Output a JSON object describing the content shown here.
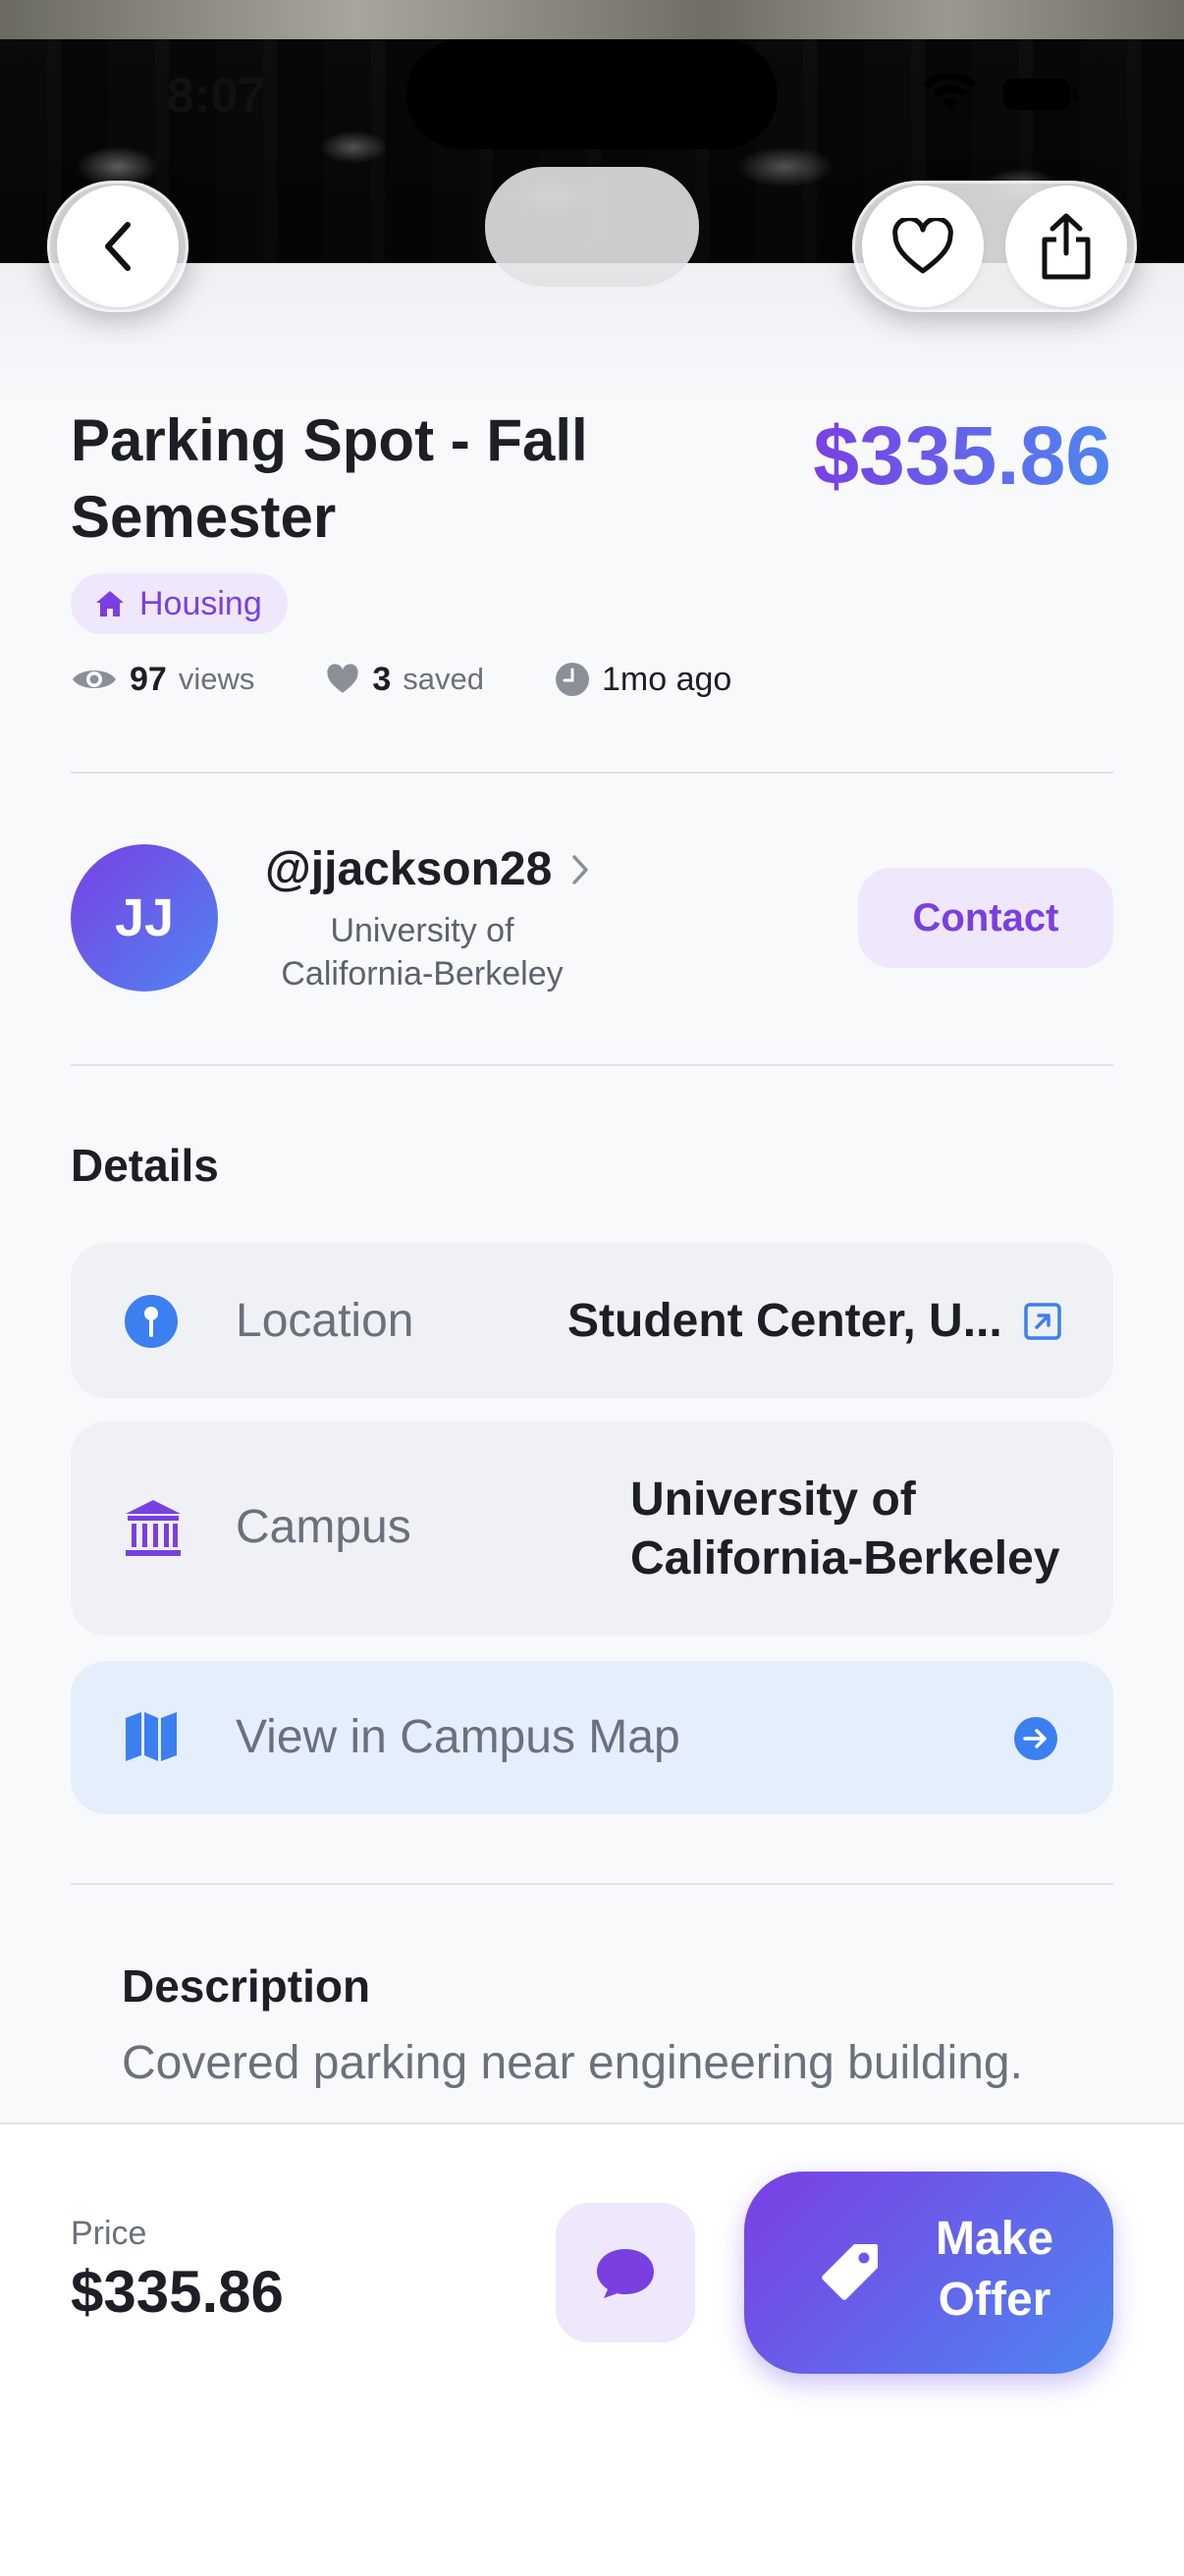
{
  "status_bar": {
    "time": "8:07"
  },
  "listing": {
    "title": "Parking Spot - Fall Semester",
    "price": "$335.86",
    "category": "Housing",
    "stats": {
      "views_count": "97",
      "views_label": "views",
      "saved_count": "3",
      "saved_label": "saved",
      "posted": "1mo ago"
    }
  },
  "seller": {
    "initials": "JJ",
    "username": "@jjackson28",
    "school": "University of California-Berkeley",
    "contact_label": "Contact"
  },
  "details": {
    "heading": "Details",
    "location_label": "Location",
    "location_value": "Student Center, U...",
    "campus_label": "Campus",
    "campus_value": "University of California-Berkeley",
    "map_label": "View in Campus Map"
  },
  "description": {
    "heading": "Description",
    "text": "Covered parking near engineering building."
  },
  "bottom_bar": {
    "price_label": "Price",
    "price": "$335.86",
    "offer_label": "Make Offer"
  },
  "colors": {
    "accent_purple": "#7b3fe4",
    "accent_blue": "#4e86f0",
    "badge_bg": "#efe7fc"
  },
  "icons": [
    "back-chevron-icon",
    "heart-icon",
    "share-icon",
    "house-icon",
    "eye-icon",
    "heart-filled-icon",
    "clock-icon",
    "chevron-right-icon",
    "location-pin-icon",
    "external-link-icon",
    "university-icon",
    "map-icon",
    "arrow-right-circle-icon",
    "chat-bubble-icon",
    "price-tag-icon"
  ]
}
